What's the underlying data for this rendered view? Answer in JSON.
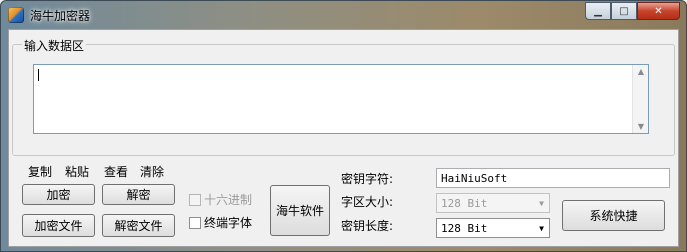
{
  "window": {
    "title": "海牛加密器",
    "minimize_glyph": "▁",
    "maximize_glyph": "□",
    "close_glyph": "✕"
  },
  "input_group": {
    "legend": "输入数据区",
    "value": ""
  },
  "edit_menu": {
    "copy": "复制",
    "paste": "粘贴",
    "view": "查看",
    "clear": "清除"
  },
  "buttons": {
    "encrypt": "加密",
    "decrypt": "解密",
    "encrypt_file": "加密文件",
    "decrypt_file": "解密文件",
    "hainiu_software": "海牛软件",
    "system_shortcut": "系统快捷"
  },
  "options": {
    "hex_label": "十六进制",
    "hex_checked": false,
    "hex_enabled": false,
    "terminal_font_label": "终端字体",
    "terminal_font_checked": false
  },
  "key_settings": {
    "key_chars_label": "密钥字符:",
    "key_chars_value": "HaiNiuSoft",
    "block_size_label": "字区大小:",
    "block_size_value": "128 Bit",
    "key_length_label": "密钥长度:",
    "key_length_value": "128 Bit"
  },
  "icons": {
    "app": "app-logo-icon",
    "dropdown": "dropdown-arrow-icon"
  }
}
